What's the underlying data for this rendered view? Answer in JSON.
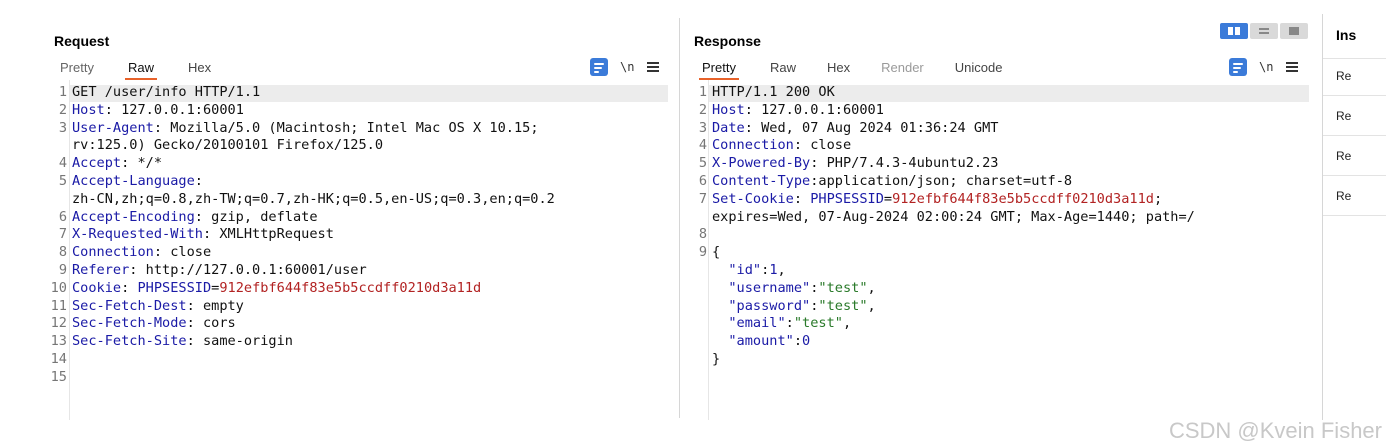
{
  "request": {
    "title": "Request",
    "tabs": [
      "Pretty",
      "Raw",
      "Hex"
    ],
    "active_tab": "Raw",
    "tools": {
      "newline_label": "\\n"
    },
    "line_numbers": [
      "1",
      "2",
      "3",
      "",
      "4",
      "5",
      "",
      "6",
      "7",
      "8",
      "9",
      "10",
      "11",
      "12",
      "13",
      "14",
      "15"
    ],
    "lines": [
      [
        {
          "t": "GET /user/info HTTP/1.1",
          "c": "v"
        }
      ],
      [
        {
          "t": "Host",
          "c": "k"
        },
        {
          "t": ": 127.0.0.1:60001",
          "c": "v"
        }
      ],
      [
        {
          "t": "User-Agent",
          "c": "k"
        },
        {
          "t": ": Mozilla/5.0 (Macintosh; Intel Mac OS X 10.15;",
          "c": "v"
        }
      ],
      [
        {
          "t": "rv:125.0) Gecko/20100101 Firefox/125.0",
          "c": "v"
        }
      ],
      [
        {
          "t": "Accept",
          "c": "k"
        },
        {
          "t": ": */*",
          "c": "v"
        }
      ],
      [
        {
          "t": "Accept-Language",
          "c": "k"
        },
        {
          "t": ":",
          "c": "v"
        }
      ],
      [
        {
          "t": "zh-CN,zh;q=0.8,zh-TW;q=0.7,zh-HK;q=0.5,en-US;q=0.3,en;q=0.2",
          "c": "v"
        }
      ],
      [
        {
          "t": "Accept-Encoding",
          "c": "k"
        },
        {
          "t": ": gzip, deflate",
          "c": "v"
        }
      ],
      [
        {
          "t": "X-Requested-With",
          "c": "k"
        },
        {
          "t": ": XMLHttpRequest",
          "c": "v"
        }
      ],
      [
        {
          "t": "Connection",
          "c": "k"
        },
        {
          "t": ": close",
          "c": "v"
        }
      ],
      [
        {
          "t": "Referer",
          "c": "k"
        },
        {
          "t": ": http://127.0.0.1:60001/user",
          "c": "v"
        }
      ],
      [
        {
          "t": "Cookie",
          "c": "k"
        },
        {
          "t": ": ",
          "c": "v"
        },
        {
          "t": "PHPSESSID",
          "c": "k"
        },
        {
          "t": "=",
          "c": "v"
        },
        {
          "t": "912efbf644f83e5b5ccdff0210d3a11d",
          "c": "sv"
        }
      ],
      [
        {
          "t": "Sec-Fetch-Dest",
          "c": "k"
        },
        {
          "t": ": empty",
          "c": "v"
        }
      ],
      [
        {
          "t": "Sec-Fetch-Mode",
          "c": "k"
        },
        {
          "t": ": cors",
          "c": "v"
        }
      ],
      [
        {
          "t": "Sec-Fetch-Site",
          "c": "k"
        },
        {
          "t": ": same-origin",
          "c": "v"
        }
      ],
      [],
      []
    ]
  },
  "response": {
    "title": "Response",
    "tabs": [
      "Pretty",
      "Raw",
      "Hex",
      "Render",
      "Unicode"
    ],
    "active_tab": "Pretty",
    "disabled_tabs": [
      "Render"
    ],
    "tools": {
      "newline_label": "\\n"
    },
    "line_numbers": [
      "1",
      "2",
      "3",
      "4",
      "5",
      "6",
      "7",
      "",
      "8",
      "9",
      "",
      "",
      "",
      "",
      ""
    ],
    "lines": [
      [
        {
          "t": "HTTP/1.1 200 OK",
          "c": "v"
        }
      ],
      [
        {
          "t": "Host",
          "c": "k"
        },
        {
          "t": ": 127.0.0.1:60001",
          "c": "v"
        }
      ],
      [
        {
          "t": "Date",
          "c": "k"
        },
        {
          "t": ": Wed, 07 Aug 2024 01:36:24 GMT",
          "c": "v"
        }
      ],
      [
        {
          "t": "Connection",
          "c": "k"
        },
        {
          "t": ": close",
          "c": "v"
        }
      ],
      [
        {
          "t": "X-Powered-By",
          "c": "k"
        },
        {
          "t": ": PHP/7.4.3-4ubuntu2.23",
          "c": "v"
        }
      ],
      [
        {
          "t": "Content-Type",
          "c": "k"
        },
        {
          "t": ":application/json; charset=utf-8",
          "c": "v"
        }
      ],
      [
        {
          "t": "Set-Cookie",
          "c": "k"
        },
        {
          "t": ": ",
          "c": "v"
        },
        {
          "t": "PHPSESSID",
          "c": "k"
        },
        {
          "t": "=",
          "c": "v"
        },
        {
          "t": "912efbf644f83e5b5ccdff0210d3a11d",
          "c": "sv"
        },
        {
          "t": ";",
          "c": "v"
        }
      ],
      [
        {
          "t": "expires=Wed, 07-Aug-2024 02:00:24 GMT; Max-Age=1440; path=/",
          "c": "v"
        }
      ],
      [],
      [
        {
          "t": "{",
          "c": "v"
        }
      ],
      [
        {
          "t": "  ",
          "c": "v"
        },
        {
          "t": "\"id\"",
          "c": "jk"
        },
        {
          "t": ":",
          "c": "v"
        },
        {
          "t": "1",
          "c": "jn"
        },
        {
          "t": ",",
          "c": "v"
        }
      ],
      [
        {
          "t": "  ",
          "c": "v"
        },
        {
          "t": "\"username\"",
          "c": "jk"
        },
        {
          "t": ":",
          "c": "v"
        },
        {
          "t": "\"test\"",
          "c": "js"
        },
        {
          "t": ",",
          "c": "v"
        }
      ],
      [
        {
          "t": "  ",
          "c": "v"
        },
        {
          "t": "\"password\"",
          "c": "jk"
        },
        {
          "t": ":",
          "c": "v"
        },
        {
          "t": "\"test\"",
          "c": "js"
        },
        {
          "t": ",",
          "c": "v"
        }
      ],
      [
        {
          "t": "  ",
          "c": "v"
        },
        {
          "t": "\"email\"",
          "c": "jk"
        },
        {
          "t": ":",
          "c": "v"
        },
        {
          "t": "\"test\"",
          "c": "js"
        },
        {
          "t": ",",
          "c": "v"
        }
      ],
      [
        {
          "t": "  ",
          "c": "v"
        },
        {
          "t": "\"amount\"",
          "c": "jk"
        },
        {
          "t": ":",
          "c": "v"
        },
        {
          "t": "0",
          "c": "jn"
        }
      ],
      [
        {
          "t": "}",
          "c": "v"
        }
      ]
    ]
  },
  "layout_switch": {
    "active": "side-by-side"
  },
  "inspector": {
    "title": "Ins",
    "items": [
      "Re",
      "Re",
      "Re",
      "Re"
    ]
  },
  "watermark": "CSDN @Kvein Fisher",
  "colors": {
    "accent": "#3b7bd9",
    "active_tab_underline": "#e8622a",
    "header_key": "#1a1aa6",
    "cookie_value": "#b22222",
    "json_string": "#2a7a2a"
  }
}
